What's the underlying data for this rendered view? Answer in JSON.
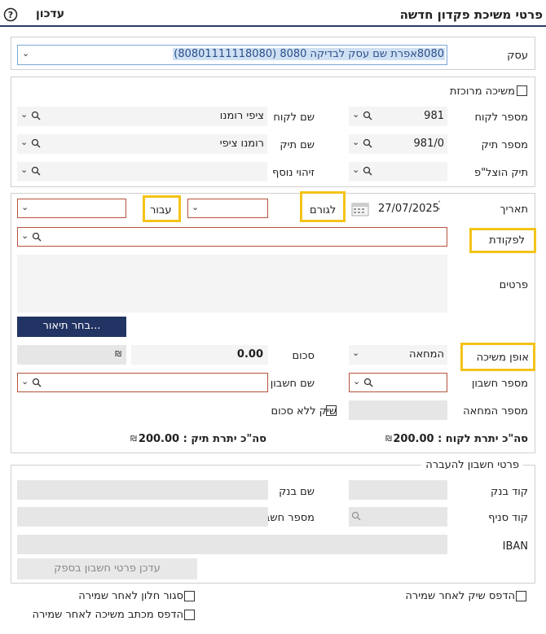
{
  "header": {
    "title": "פרטי משיכת פקדון חדשה",
    "update_label": "עדכון",
    "help_icon": "help-circle-icon"
  },
  "business": {
    "label": "עסק",
    "value": "8080אפרת שם עסק לבדיקה 8080 (80801111118080)"
  },
  "client_section": {
    "merged_withdrawal_label": "משיכה מרוכזת",
    "merged_withdrawal_checked": false,
    "client_number_label": "מספר לקוח",
    "client_number_value": "981",
    "client_name_label": "שם לקוח",
    "client_name_value": "ציפי רומנו",
    "file_number_label": "מספר תיק",
    "file_number_value": "981/0",
    "file_name_label": "שם תיק",
    "file_name_value": "רומנו ציפי",
    "expense_file_label": "תיק הוצל\"פ",
    "expense_file_value": "",
    "extra_id_label": "זיהוי נוסף",
    "extra_id_value": ""
  },
  "details_section": {
    "date_label": "תאריך",
    "date_value": "27/07/2025",
    "factor_button": "לגורם",
    "for_button": "עבור",
    "order_label": "לפקודת",
    "details_label": "פרטים",
    "details_value": "",
    "choose_description_button": "בחר תיאור...",
    "withdrawal_method_label": "אופן משיכה",
    "withdrawal_method_value": "המחאה",
    "amount_label": "סכום",
    "amount_value": "0.00",
    "currency_symbol": "₪",
    "account_number_label": "מספר חשבון",
    "account_name_label": "שם חשבון",
    "check_number_label": "מספר המחאה",
    "check_no_amount_label": "שיק ללא סכום",
    "check_no_amount_checked": false,
    "client_balance_text": "סה\"כ יתרת לקוח : 200.00",
    "file_balance_text": "סה\"כ יתרת תיק : 200.00"
  },
  "transfer_section": {
    "legend": "פרטי חשבון להעברה",
    "bank_code_label": "קוד בנק",
    "bank_name_label": "שם בנק",
    "branch_code_label": "קוד סניף",
    "account_number_label": "מספר חשבון",
    "iban_label": "IBAN",
    "update_supplier_button": "עדכן פרטי חשבון בספק"
  },
  "footer": {
    "print_check_label": "הדפס שיק לאחר שמירה",
    "close_window_label": "סגור חלון לאחר שמירה",
    "print_letter_label": "הדפס מכתב משיכה לאחר שמירה"
  }
}
